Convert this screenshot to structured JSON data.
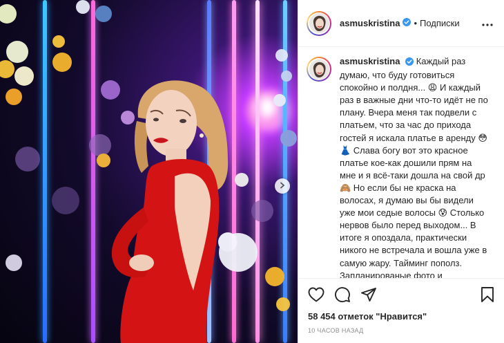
{
  "header": {
    "username": "asmuskristina",
    "separator": "•",
    "follow_label": "Подписки"
  },
  "caption": {
    "username": "asmuskristina",
    "text": "Каждый раз думаю, что буду готовиться спокойно и полдня... 😩 И каждый раз в важные дни что-то идёт не по плану. Вчера меня так подвели с платьем, что за час до прихода гостей я искала платье в аренду 😳👗 Слава богу вот это красное платье кое-как дошили прям на мне и я всё-таки дошла на свой др 🙈 Но если бы не краска на волосах, я думаю вы бы видели уже мои седые волосы 😰 Столько нервов было перед выходом... В итоге я опоздала, практически никого не встречала и вошла уже в самую жару. Тайминг пополз. Запланированые фото и видеосъемки не состоялись. Но!!! Через полчаса я уже забыла об этом. Ну и шампанское 🥂"
  },
  "stats": {
    "likes_text": "58 454 отметок \"Нравится\"",
    "time_text": "10 часов назад"
  },
  "icons": {
    "verified": "verified-badge-icon",
    "more": "more-options-icon",
    "like": "heart-icon",
    "comment": "comment-icon",
    "share": "share-icon",
    "save": "bookmark-icon",
    "next": "chevron-right-icon"
  },
  "colors": {
    "verified": "#3897f0",
    "text": "#262626",
    "muted": "#8e8e8e",
    "dress": "#d41414"
  }
}
